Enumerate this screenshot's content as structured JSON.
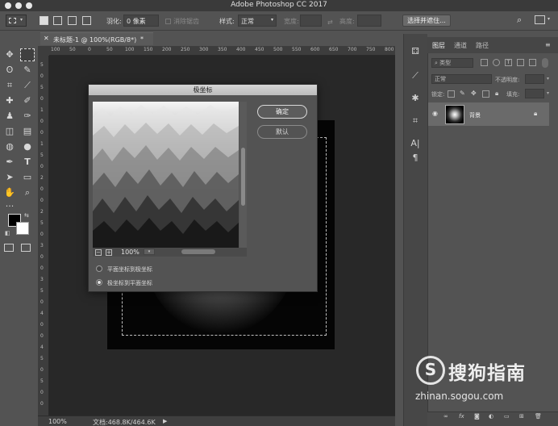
{
  "app": {
    "title": "Adobe Photoshop CC 2017"
  },
  "options_bar": {
    "feather_label": "羽化:",
    "feather_value": "0 像素",
    "antialias_label": "消除锯齿",
    "style_label": "样式:",
    "style_value": "正常",
    "width_label": "宽度:",
    "height_label": "高度:",
    "refine_button": "选择并遮住..."
  },
  "document": {
    "tab_title": "未标题-1 @ 100%(RGB/8*)",
    "tab_modified_mark": "*",
    "ruler_ticks_h": [
      "100",
      "50",
      "0",
      "50",
      "100",
      "150",
      "200",
      "250",
      "300",
      "350",
      "400",
      "450",
      "500",
      "550",
      "600",
      "650",
      "700",
      "750",
      "800"
    ],
    "ruler_ticks_v": [
      "5",
      "0",
      "5",
      "0",
      "1",
      "0",
      "0",
      "1",
      "5",
      "0",
      "2",
      "0",
      "0",
      "2",
      "5",
      "0",
      "3",
      "0",
      "0",
      "3",
      "5",
      "0",
      "4",
      "0",
      "0",
      "4",
      "5",
      "0",
      "5",
      "0",
      "0"
    ]
  },
  "status_bar": {
    "zoom": "100%",
    "doc_info": "文档:468.8K/464.6K"
  },
  "dialog": {
    "title": "极坐标",
    "ok_button": "确定",
    "default_button": "默认",
    "zoom_value": "100%",
    "option_rect_to_polar": "平面坐标到极坐标",
    "option_polar_to_rect": "极坐标到平面坐标",
    "selected_option": "polar_to_rect"
  },
  "layers_panel": {
    "tabs": [
      "图层",
      "通道",
      "路径"
    ],
    "active_tab": "图层",
    "kind_filter": "类型",
    "blend_mode": "正常",
    "opacity_label": "不透明度:",
    "lock_label": "锁定:",
    "fill_label": "填充:",
    "layer_name": "背景"
  },
  "watermark": {
    "brand": "搜狗指南",
    "url": "zhinan.sogou.com"
  },
  "colors": {
    "accent_dialog_title": "#c8c8c8",
    "canvas_bg": "#282828",
    "panel_bg": "#535353"
  }
}
